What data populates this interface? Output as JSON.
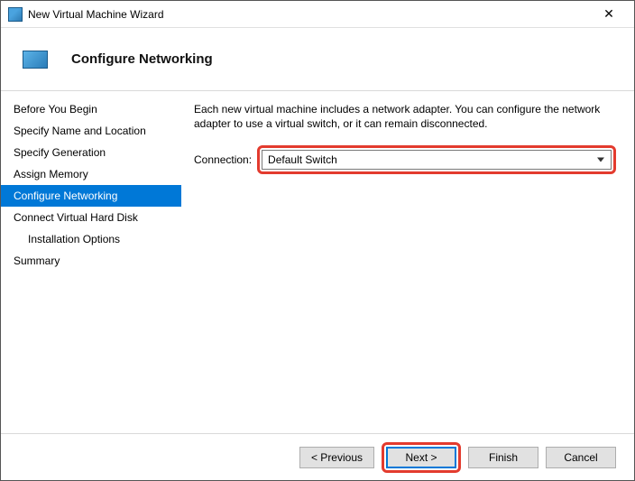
{
  "window": {
    "title": "New Virtual Machine Wizard"
  },
  "header": {
    "title": "Configure Networking"
  },
  "sidebar": {
    "steps": [
      {
        "label": "Before You Begin",
        "active": false,
        "indent": false
      },
      {
        "label": "Specify Name and Location",
        "active": false,
        "indent": false
      },
      {
        "label": "Specify Generation",
        "active": false,
        "indent": false
      },
      {
        "label": "Assign Memory",
        "active": false,
        "indent": false
      },
      {
        "label": "Configure Networking",
        "active": true,
        "indent": false
      },
      {
        "label": "Connect Virtual Hard Disk",
        "active": false,
        "indent": false
      },
      {
        "label": "Installation Options",
        "active": false,
        "indent": true
      },
      {
        "label": "Summary",
        "active": false,
        "indent": false
      }
    ]
  },
  "content": {
    "description": "Each new virtual machine includes a network adapter. You can configure the network adapter to use a virtual switch, or it can remain disconnected.",
    "connection_label": "Connection:",
    "connection_value": "Default Switch"
  },
  "footer": {
    "previous": "< Previous",
    "next": "Next >",
    "finish": "Finish",
    "cancel": "Cancel"
  }
}
